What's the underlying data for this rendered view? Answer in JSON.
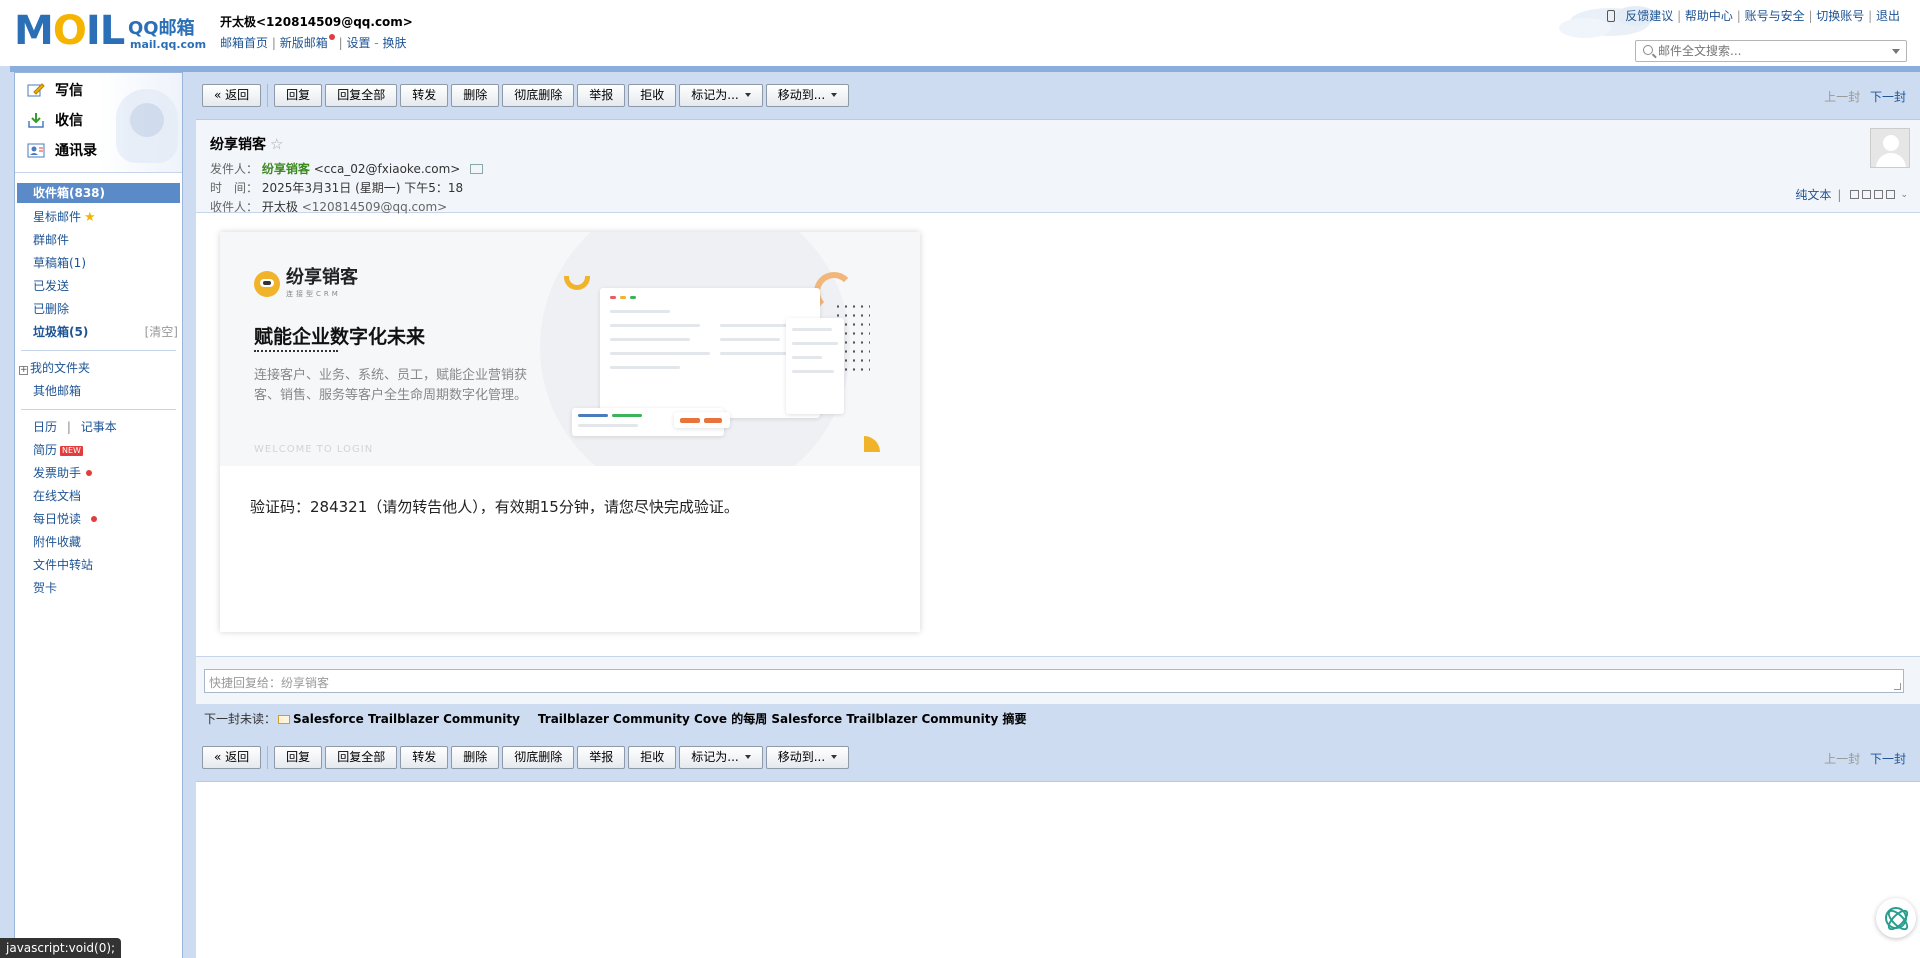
{
  "header": {
    "logo_text": "MOIL",
    "brand_cn": "QQ邮箱",
    "brand_url": "mail.qq.com",
    "user_display": "开太极<120814509@qq.com>",
    "links": {
      "home": "邮箱首页",
      "new_version": "新版邮箱",
      "settings": "设置",
      "dash": "-",
      "skin": "换肤",
      "sep": "|"
    },
    "top_links": [
      "反馈建议",
      "帮助中心",
      "账号与安全",
      "切换账号",
      "退出"
    ],
    "search_placeholder": "邮件全文搜索..."
  },
  "sidebar": {
    "quick": {
      "compose": "写信",
      "receive": "收信",
      "contacts": "通讯录"
    },
    "folders": {
      "inbox": "收件箱(838)",
      "starred": "星标邮件",
      "group": "群邮件",
      "drafts": "草稿箱(1)",
      "sent": "已发送",
      "deleted": "已删除",
      "spam": "垃圾箱(5)",
      "spam_clear": "[清空]",
      "my_folders": "我的文件夹",
      "other_mailbox": "其他邮箱"
    },
    "apps": {
      "calendar": "日历",
      "notes": "记事本",
      "pipe": "|",
      "resume": "简历",
      "new_badge": "NEW",
      "invoice": "发票助手",
      "online_docs": "在线文档",
      "daily_read": "每日悦读",
      "attachments": "附件收藏",
      "file_transfer": "文件中转站",
      "cards": "贺卡"
    }
  },
  "toolbar": {
    "back": "« 返回",
    "reply": "回复",
    "reply_all": "回复全部",
    "forward": "转发",
    "delete": "删除",
    "delete_forever": "彻底删除",
    "report": "举报",
    "reject": "拒收",
    "mark_as": "标记为...",
    "move_to": "移动到...",
    "prev": "上一封",
    "next": "下一封"
  },
  "mail": {
    "subject": "纷享销客",
    "star": "☆",
    "from_label": "发件人：",
    "from_name": "纷享销客",
    "from_email": "<cca_02@fxiaoke.com>",
    "time_label": "时　间：",
    "time_value": "2025年3月31日 (星期一) 下午5：18",
    "to_label": "收件人：",
    "to_name": "开太极",
    "to_email": "<120814509@qq.com>",
    "plain_text": "纯文本",
    "pipe": "|"
  },
  "banner": {
    "brand_name": "纷享销客",
    "brand_sub": "连接型CRM",
    "tagline": "赋能企业数字化未来",
    "description": "连接客户、业务、系统、员工，赋能企业营销获客、销售、服务等客户全生命周期数字化管理。",
    "welcome": "WELCOME TO LOGIN"
  },
  "content": {
    "code_line": "验证码：284321（请勿转告他人），有效期15分钟，请您尽快完成验证。"
  },
  "quick_reply": {
    "placeholder": "快捷回复给：纷享销客"
  },
  "next_unread": {
    "label": "下一封未读：",
    "sender": "Salesforce Trailblazer Community",
    "subject": "Trailblazer Community Cove 的每周 Salesforce Trailblazer Community 摘要"
  },
  "statusbar": {
    "text": "javascript:void(0);"
  },
  "colors": {
    "frame": "#cddcf0",
    "accent": "#1e5494",
    "active_folder": "#5b8ac9"
  }
}
